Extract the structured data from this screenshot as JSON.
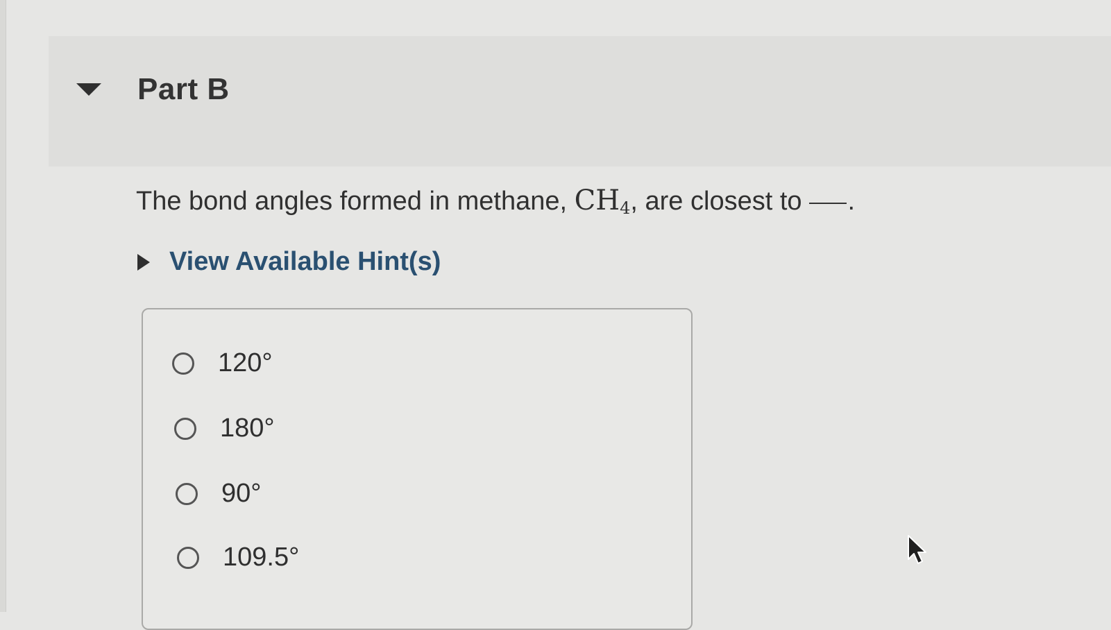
{
  "part": {
    "title": "Part B",
    "toggle_icon": "triangle-down-icon"
  },
  "question": {
    "text_before": "The bond angles formed in methane, ",
    "formula_main": "CH",
    "formula_sub": "4",
    "text_after": ", are closest to",
    "end": "."
  },
  "hints": {
    "label": "View Available Hint(s)",
    "icon": "triangle-right-icon"
  },
  "choices": [
    {
      "label": "120°"
    },
    {
      "label": "180°"
    },
    {
      "label": "90°"
    },
    {
      "label": "109.5°"
    }
  ],
  "colors": {
    "hint_link": "#2a5071",
    "background": "#e6e6e4",
    "header_band": "#dededc"
  }
}
